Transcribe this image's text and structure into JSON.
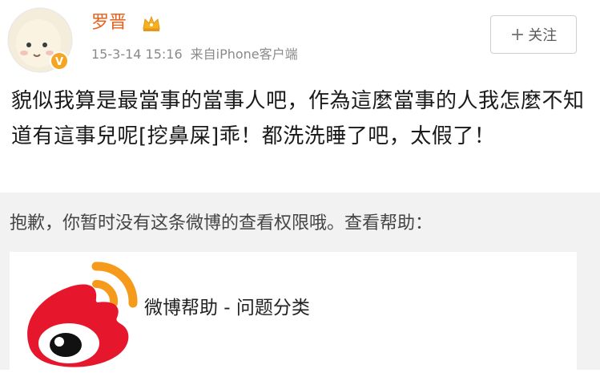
{
  "post": {
    "username": "罗晋",
    "timestamp": "15-3-14 15:16",
    "source": "来自iPhone客户端",
    "follow_plus": "+",
    "follow_label": "关注",
    "text": "貌似我算是最當事的當事人吧，作為這麼當事的人我怎麼不知道有這事兒呢[挖鼻屎]乖！都洗洗睡了吧，太假了！"
  },
  "notice": {
    "text": "抱歉，你暂时没有这条微博的查看权限哦。查看帮助：",
    "card_title": "微博帮助 - 问题分类"
  },
  "colors": {
    "username": "#e8601a",
    "weibo_red": "#e6162d",
    "weibo_orange": "#f59a1b",
    "notice_bg": "#f2f2f2"
  }
}
